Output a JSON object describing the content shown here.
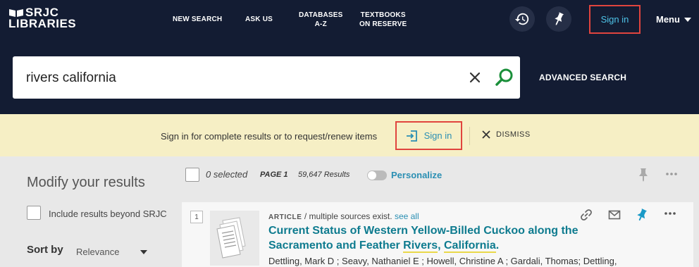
{
  "brand": {
    "line1": "SRJC",
    "line2": "LIBRARIES"
  },
  "nav": {
    "new_search": "NEW SEARCH",
    "ask_us": "ASK US",
    "databases_1": "DATABASES",
    "databases_2": "A-Z",
    "textbooks_1": "TEXTBOOKS",
    "textbooks_2": "ON RESERVE",
    "sign_in": "Sign in",
    "menu": "Menu"
  },
  "search": {
    "query": "rivers california",
    "advanced": "ADVANCED SEARCH"
  },
  "notice": {
    "message": "Sign in for complete results or to request/renew items",
    "sign_in": "Sign in",
    "dismiss": "DISMISS"
  },
  "facets": {
    "heading": "Modify your results",
    "include_beyond": "Include results beyond SRJC",
    "sort_label": "Sort by",
    "sort_value": "Relevance"
  },
  "results_header": {
    "selected": "0 selected",
    "page": "PAGE 1",
    "count": "59,647 Results",
    "personalize": "Personalize",
    "personalize_on": false
  },
  "result": {
    "number": "1",
    "type": "ARTICLE",
    "source_note": "/ multiple sources exist.",
    "see_all": "see all",
    "title_part1": "Current Status of Western Yellow-Billed Cuckoo along the Sacramento and Feather ",
    "title_hl1": "Rivers",
    "title_sep": ", ",
    "title_hl2": "California",
    "title_end": ".",
    "authors": "Dettling, Mark D ; Seavy, Nathaniel E ; Howell, Christine A ; Gardali, Thomas; Dettling,"
  },
  "colors": {
    "header_bg": "#131c33",
    "notice_bg": "#f6efc5",
    "accent": "#2b8fb3",
    "title": "#0e7b8f",
    "highlight_box": "#e0443e"
  }
}
